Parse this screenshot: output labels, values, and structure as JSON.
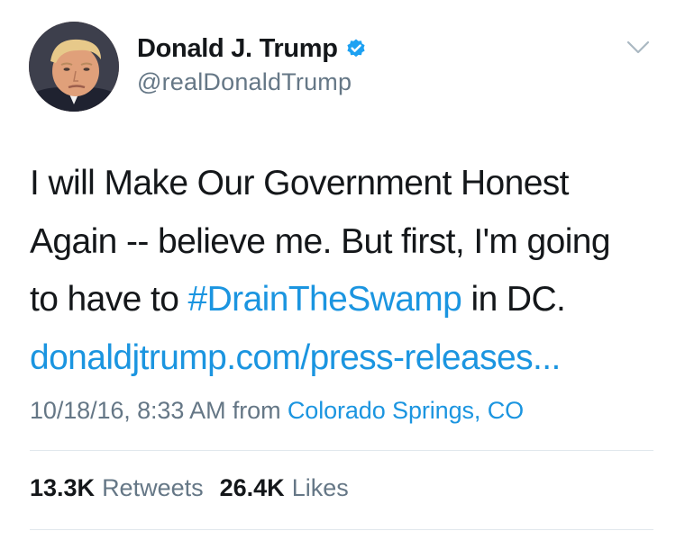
{
  "tweet": {
    "author": {
      "display_name": "Donald J. Trump",
      "handle": "@realDonaldTrump",
      "verified": true,
      "avatar_icon": "profile-photo"
    },
    "text_lines": {
      "line1": "I will Make Our Government Honest",
      "line2": "Again -- believe me. But first, I'm going",
      "line3_before": "to have to ",
      "hashtag": "#DrainTheSwamp",
      "line3_after": " in DC.",
      "url": "donaldjtrump.com/press-releases..."
    },
    "meta": {
      "timestamp": "10/18/16, 8:33 AM",
      "from_label": " from ",
      "location": "Colorado Springs, CO"
    },
    "stats": {
      "retweets_count": "13.3K",
      "retweets_label": "Retweets",
      "likes_count": "26.4K",
      "likes_label": "Likes"
    }
  },
  "colors": {
    "link": "#1b95e0",
    "secondary_text": "#657786",
    "primary_text": "#14171a",
    "verified_badge": "#1da1f2",
    "divider": "#e1e8ed"
  },
  "icons": {
    "verified": "verified-badge-icon",
    "menu": "chevron-down-icon"
  }
}
